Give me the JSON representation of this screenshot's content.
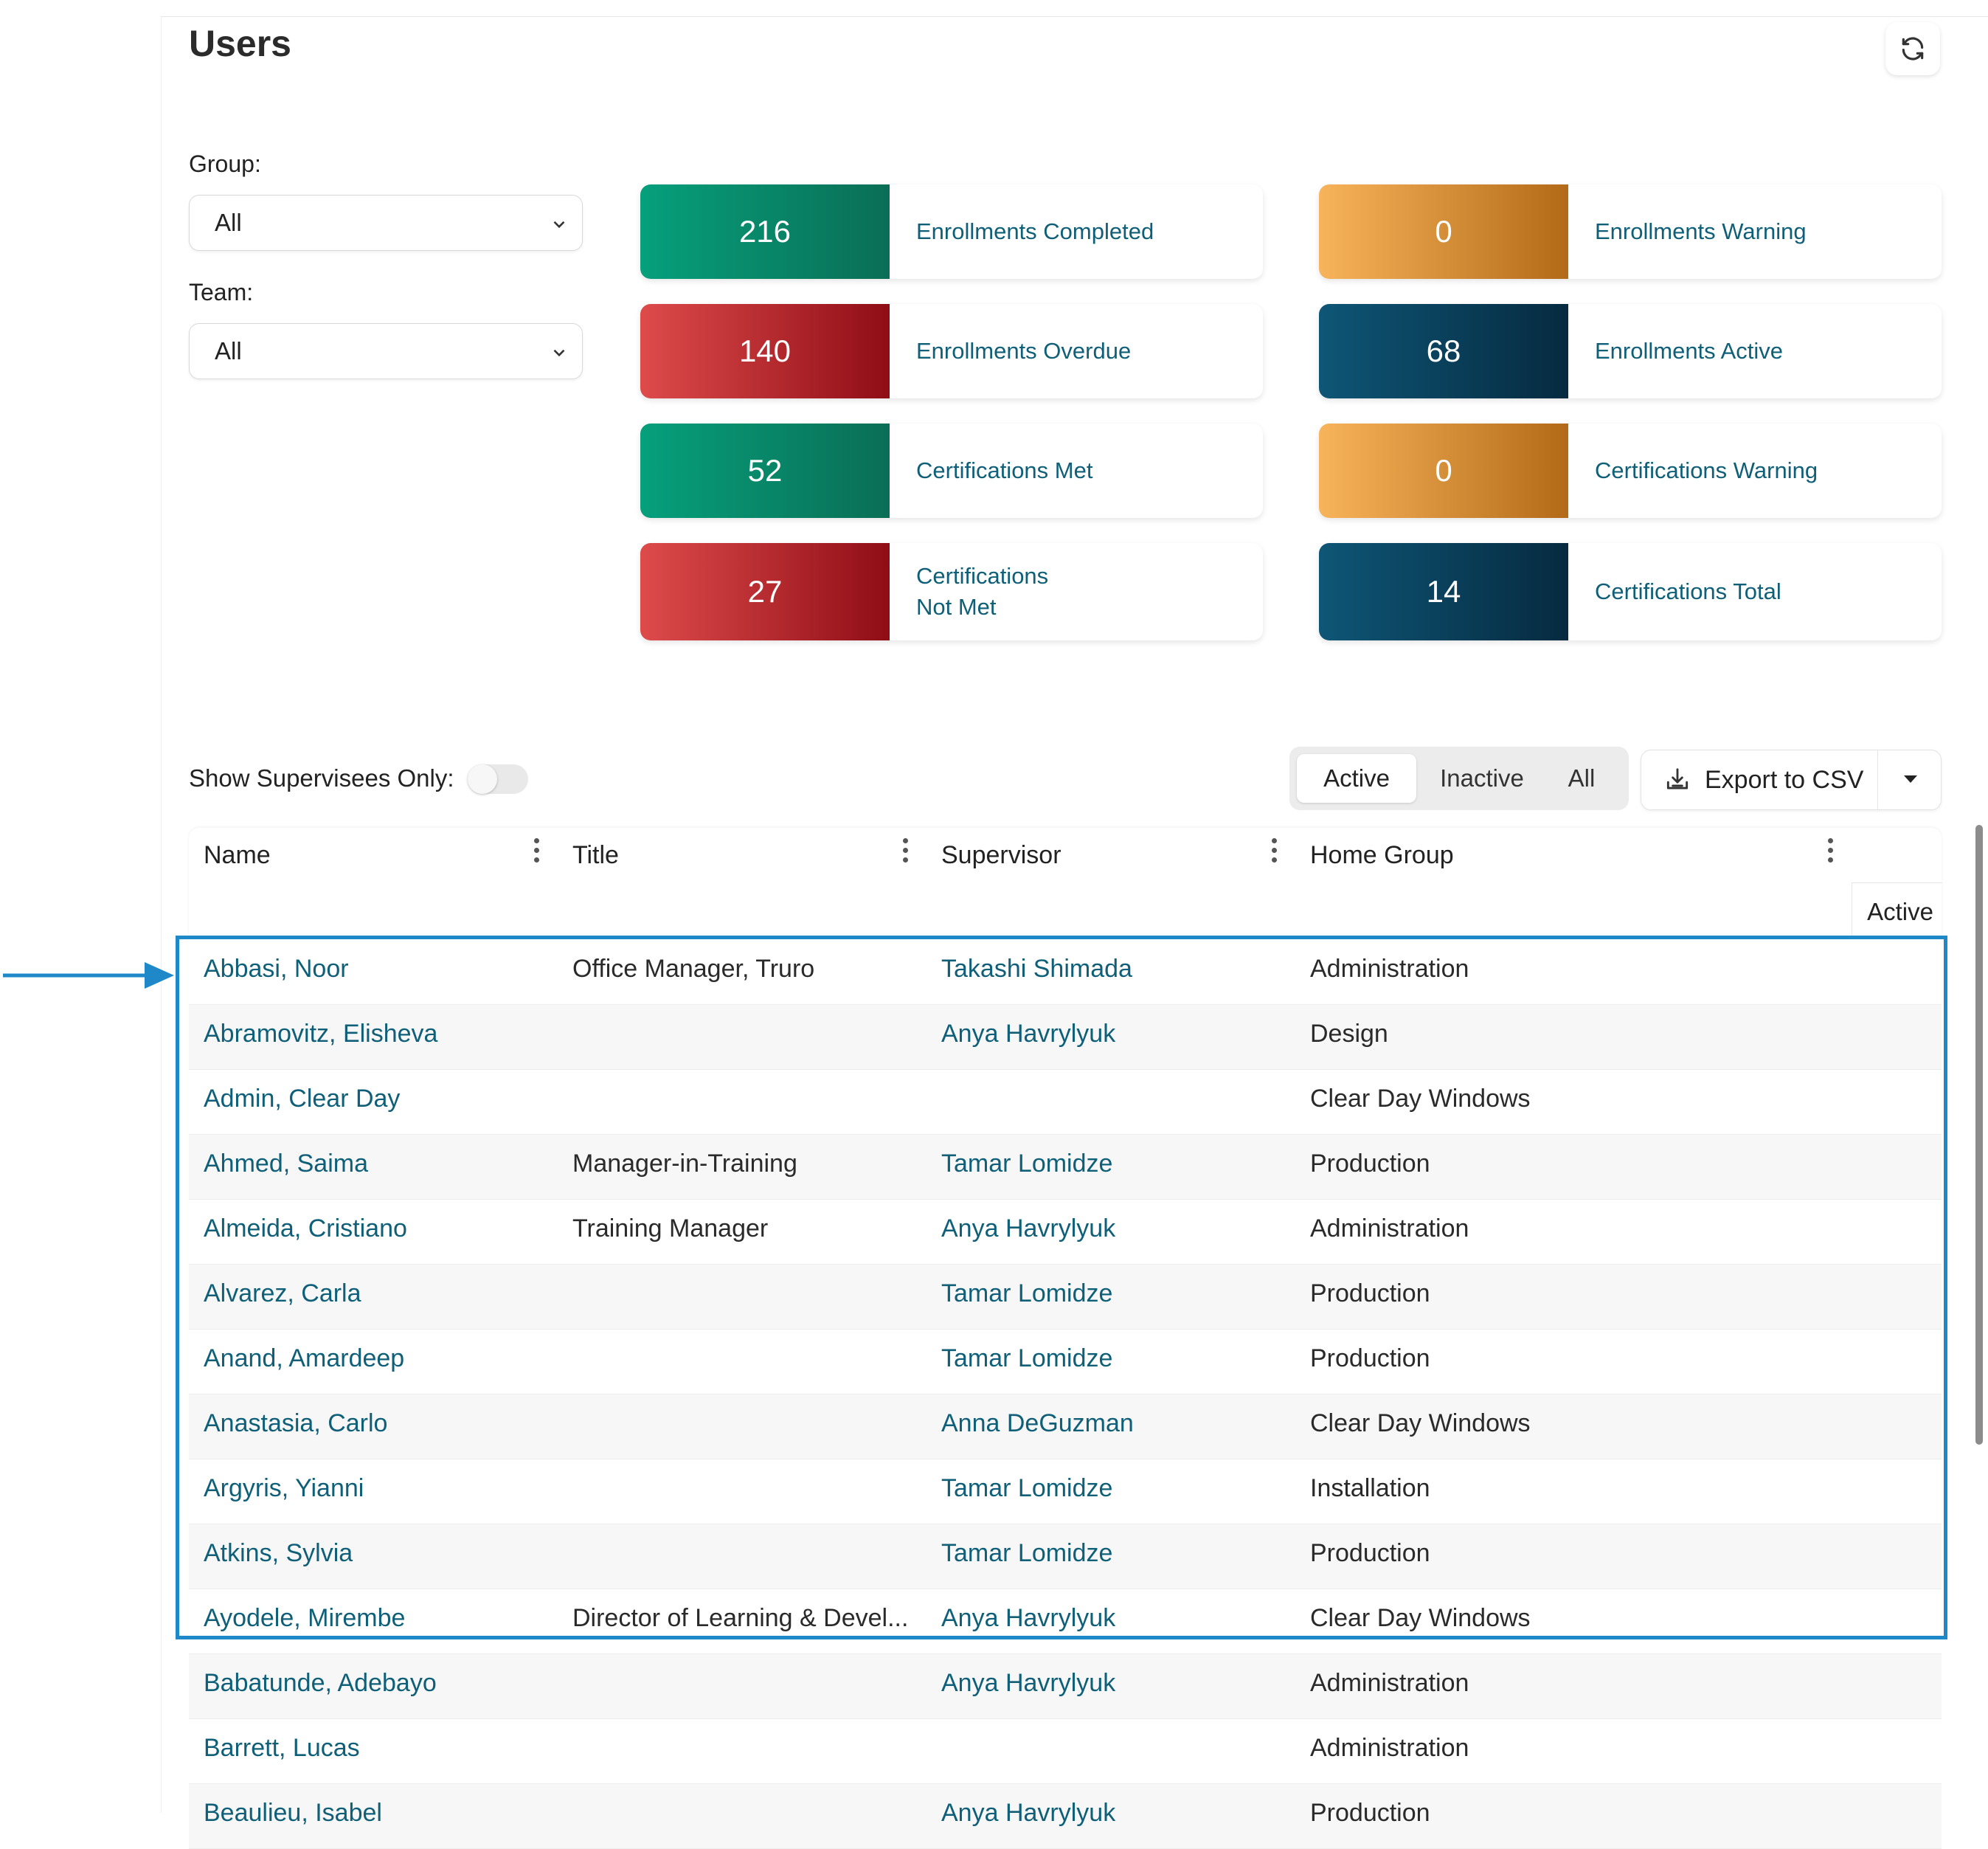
{
  "page": {
    "title": "Users"
  },
  "filters": {
    "group_label": "Group:",
    "group_value": "All",
    "team_label": "Team:",
    "team_value": "All"
  },
  "stats": [
    {
      "value": "216",
      "label": "Enrollments Completed",
      "color": "green"
    },
    {
      "value": "0",
      "label": "Enrollments Warning",
      "color": "orange"
    },
    {
      "value": "140",
      "label": "Enrollments Overdue",
      "color": "red"
    },
    {
      "value": "68",
      "label": "Enrollments Active",
      "color": "navy"
    },
    {
      "value": "52",
      "label": "Certifications Met",
      "color": "green"
    },
    {
      "value": "0",
      "label": "Certifications Warning",
      "color": "orange"
    },
    {
      "value": "27",
      "label": "Certifications\nNot Met",
      "color": "red"
    },
    {
      "value": "14",
      "label": "Certifications Total",
      "color": "navy"
    }
  ],
  "colors": {
    "green": "#0a8a6a",
    "red": "#b3202a",
    "orange": "#e0922f",
    "navy": "#0a3d57",
    "link": "#0f5f78",
    "highlight": "#1e88c8"
  },
  "toolbar": {
    "supervisees_label": "Show Supervisees Only:",
    "supervisees_on": false,
    "segment": [
      "Active",
      "Inactive",
      "All"
    ],
    "segment_selected": "Active",
    "export_label": "Export to CSV"
  },
  "table": {
    "columns": [
      "Name",
      "Title",
      "Supervisor",
      "Home Group"
    ],
    "extra_column": "Active",
    "rows": [
      {
        "name": "Abbasi, Noor",
        "title": "Office Manager, Truro",
        "supervisor": "Takashi Shimada",
        "group": "Administration"
      },
      {
        "name": "Abramovitz, Elisheva",
        "title": "",
        "supervisor": "Anya Havrylyuk",
        "group": "Design"
      },
      {
        "name": "Admin, Clear Day",
        "title": "",
        "supervisor": "",
        "group": "Clear Day Windows"
      },
      {
        "name": "Ahmed, Saima",
        "title": "Manager-in-Training",
        "supervisor": "Tamar Lomidze",
        "group": "Production"
      },
      {
        "name": "Almeida, Cristiano",
        "title": "Training Manager",
        "supervisor": "Anya Havrylyuk",
        "group": "Administration"
      },
      {
        "name": "Alvarez, Carla",
        "title": "",
        "supervisor": "Tamar Lomidze",
        "group": "Production"
      },
      {
        "name": "Anand, Amardeep",
        "title": "",
        "supervisor": "Tamar Lomidze",
        "group": "Production"
      },
      {
        "name": "Anastasia, Carlo",
        "title": "",
        "supervisor": "Anna DeGuzman",
        "group": "Clear Day Windows"
      },
      {
        "name": "Argyris, Yianni",
        "title": "",
        "supervisor": "Tamar Lomidze",
        "group": "Installation"
      },
      {
        "name": "Atkins, Sylvia",
        "title": "",
        "supervisor": "Tamar Lomidze",
        "group": "Production"
      },
      {
        "name": "Ayodele, Mirembe",
        "title": "Director of Learning & Devel...",
        "supervisor": "Anya Havrylyuk",
        "group": "Clear Day Windows"
      },
      {
        "name": "Babatunde, Adebayo",
        "title": "",
        "supervisor": "Anya Havrylyuk",
        "group": "Administration"
      },
      {
        "name": "Barrett, Lucas",
        "title": "",
        "supervisor": "",
        "group": "Administration"
      },
      {
        "name": "Beaulieu, Isabel",
        "title": "",
        "supervisor": "Anya Havrylyuk",
        "group": "Production"
      }
    ]
  }
}
